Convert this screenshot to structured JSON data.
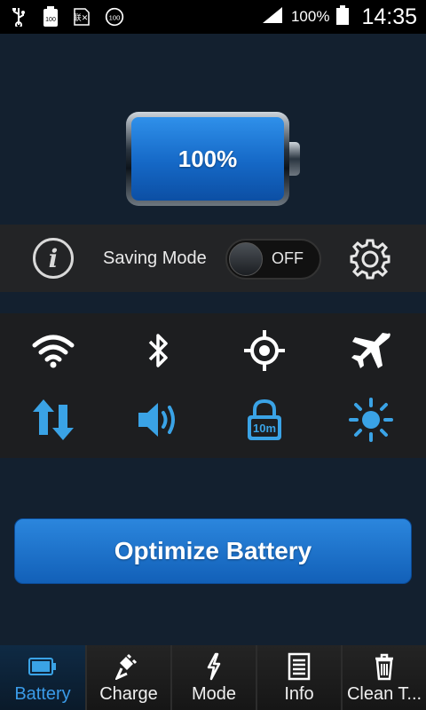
{
  "status_bar": {
    "left_icons": [
      "usb-icon",
      "battery-100-icon",
      "sim-off-icon",
      "badge-100-icon"
    ],
    "badge_small": "100",
    "badge_round": "100",
    "sim_text": "联✕",
    "signal": "signal-icon",
    "battery_percent": "100%",
    "time": "14:35"
  },
  "battery": {
    "level_text": "100%",
    "level": 1.0,
    "color": "#1f7ad8"
  },
  "saving_mode": {
    "label": "Saving Mode",
    "toggle_state": "OFF",
    "info_glyph": "i"
  },
  "quick_settings": [
    {
      "icon": "wifi-icon",
      "active": false
    },
    {
      "icon": "bluetooth-icon",
      "active": false
    },
    {
      "icon": "gps-icon",
      "active": false
    },
    {
      "icon": "airplane-icon",
      "active": false
    },
    {
      "icon": "mobile-data-icon",
      "active": true
    },
    {
      "icon": "sound-icon",
      "active": true
    },
    {
      "icon": "screen-timeout-icon",
      "active": true,
      "label": "10m"
    },
    {
      "icon": "brightness-icon",
      "active": true
    }
  ],
  "colors": {
    "accent": "#3aa3e6",
    "inactive": "#ffffff"
  },
  "optimize": {
    "label": "Optimize Battery"
  },
  "bottom_nav": [
    {
      "label": "Battery",
      "icon": "battery-icon",
      "active": true
    },
    {
      "label": "Charge",
      "icon": "plug-icon",
      "active": false
    },
    {
      "label": "Mode",
      "icon": "lightning-icon",
      "active": false
    },
    {
      "label": "Info",
      "icon": "document-icon",
      "active": false
    },
    {
      "label": "Clean T...",
      "icon": "trash-icon",
      "active": false
    }
  ]
}
